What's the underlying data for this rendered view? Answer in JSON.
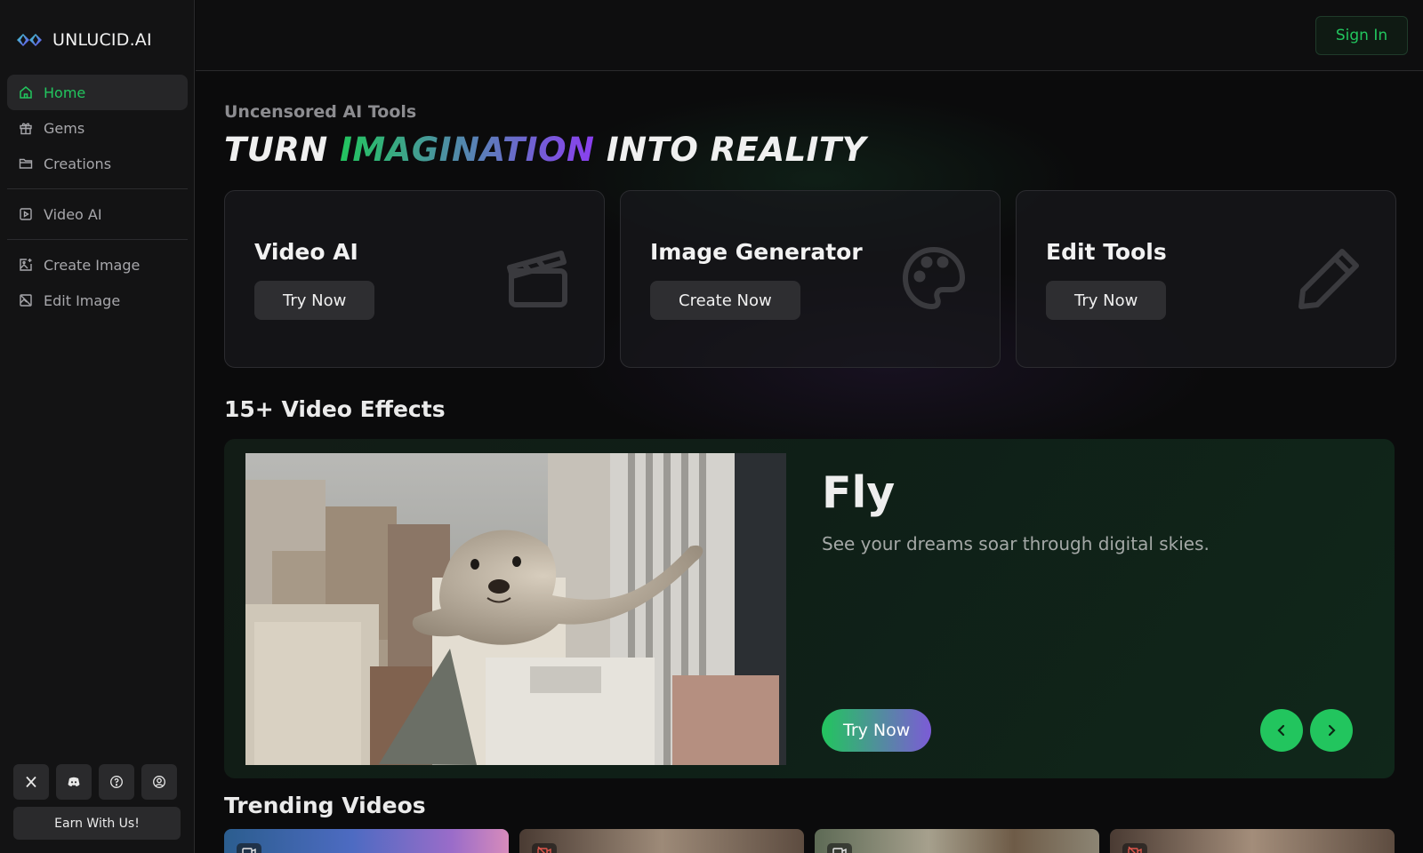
{
  "brand": {
    "name": "UNLUCID.AI",
    "logo_icon": "unlucid-logo-icon"
  },
  "sidebar": {
    "items": [
      {
        "label": "Home",
        "icon": "home-icon",
        "active": true
      },
      {
        "label": "Gems",
        "icon": "gift-icon"
      },
      {
        "label": "Creations",
        "icon": "folder-icon"
      },
      {
        "label": "Video AI",
        "icon": "play-square-icon"
      },
      {
        "label": "Create Image",
        "icon": "image-plus-icon"
      },
      {
        "label": "Edit Image",
        "icon": "image-edit-icon"
      }
    ],
    "social": [
      "x-icon",
      "discord-icon",
      "help-icon",
      "user-circle-icon"
    ],
    "earn_label": "Earn With Us!"
  },
  "header": {
    "signin_label": "Sign In"
  },
  "hero": {
    "kicker": "Uncensored AI Tools",
    "title_part1": "TURN",
    "title_highlight": "IMAGINATION",
    "title_part2": "INTO REALITY"
  },
  "tools": [
    {
      "title": "Video AI",
      "button": "Try Now",
      "icon": "clapperboard-icon"
    },
    {
      "title": "Image Generator",
      "button": "Create Now",
      "icon": "palette-icon"
    },
    {
      "title": "Edit Tools",
      "button": "Try Now",
      "icon": "pencil-icon"
    }
  ],
  "effects": {
    "section_title": "15+ Video Effects",
    "name": "Fly",
    "description": "See your dreams soar through digital skies.",
    "try_label": "Try Now",
    "prev_icon": "chevron-left-icon",
    "next_icon": "chevron-right-icon"
  },
  "trending": {
    "section_title": "Trending Videos"
  },
  "colors": {
    "accent": "#22c55e",
    "purple": "#8b3ff0",
    "bg": "#0b0b0c"
  }
}
